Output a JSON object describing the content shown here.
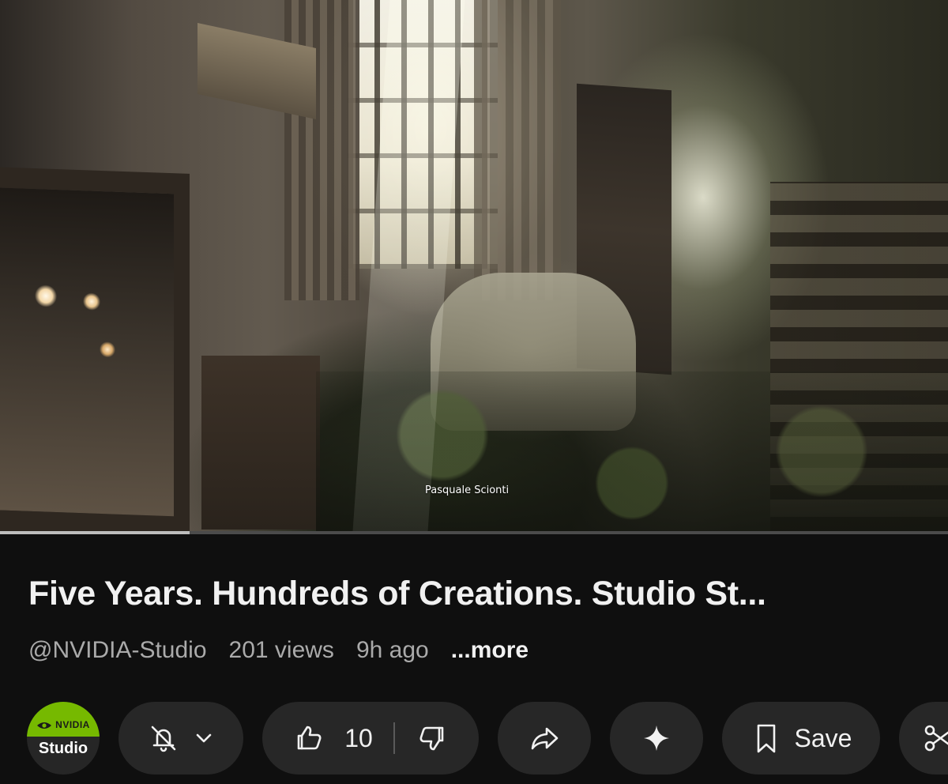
{
  "video": {
    "caption": "Pasquale Scionti",
    "progress_percent": 20
  },
  "title": "Five Years. Hundreds of Creations. Studio St...",
  "meta": {
    "channel": "@NVIDIA-Studio",
    "views": "201 views",
    "age": "9h ago",
    "more": "...more"
  },
  "avatar": {
    "brand": "NVIDIA",
    "sub": "Studio",
    "brand_color": "#76b900"
  },
  "actions": {
    "like_count": "10",
    "save_label": "Save"
  },
  "icons": {
    "notifications": "bell-off-icon",
    "dropdown": "chevron-down-icon",
    "like": "thumbs-up-icon",
    "dislike": "thumbs-down-icon",
    "share": "share-icon",
    "ask": "sparkle-icon",
    "save": "bookmark-icon",
    "clip": "scissors-icon"
  }
}
